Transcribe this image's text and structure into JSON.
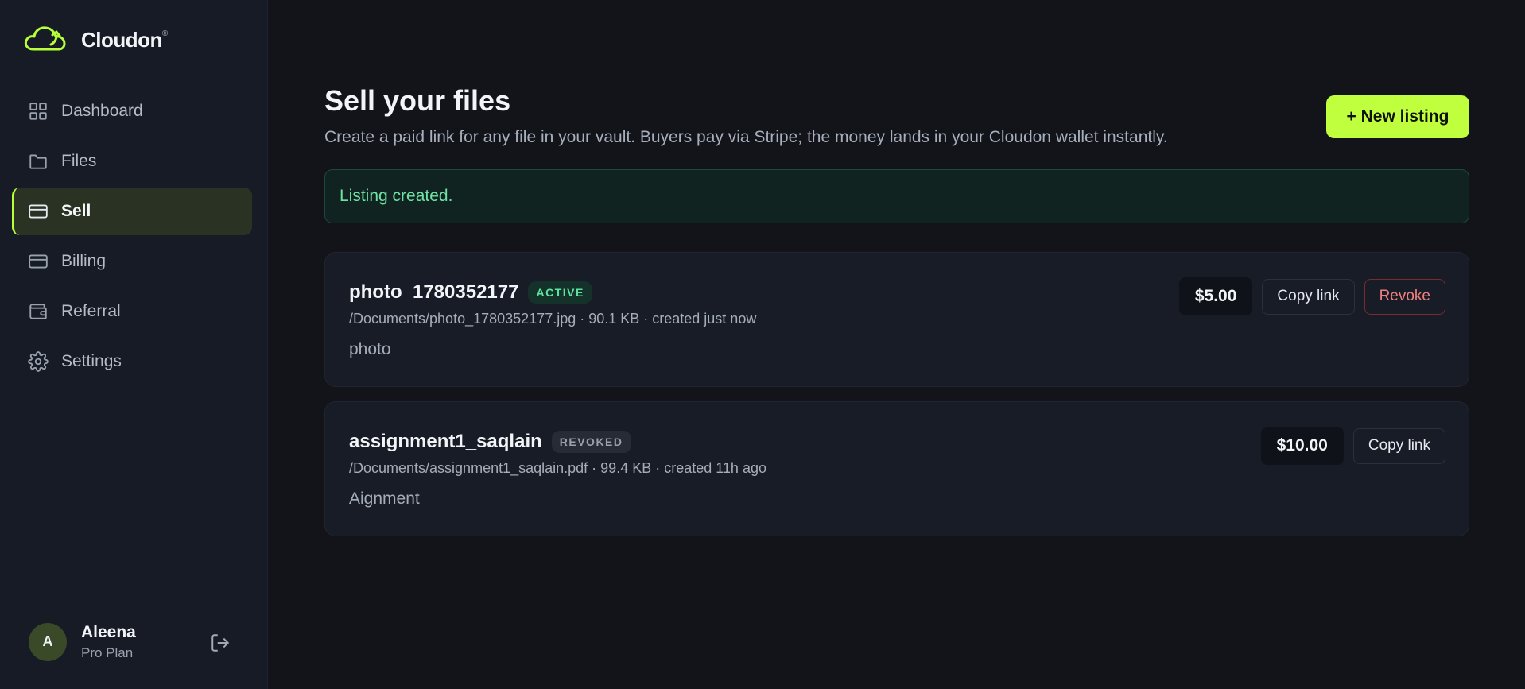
{
  "brand": {
    "name": "Cloudon",
    "mark": "®",
    "accent": "#b6ff3b"
  },
  "sidebar": {
    "items": [
      {
        "label": "Dashboard",
        "icon": "grid-icon"
      },
      {
        "label": "Files",
        "icon": "folder-icon"
      },
      {
        "label": "Sell",
        "icon": "card-icon",
        "active": true
      },
      {
        "label": "Billing",
        "icon": "card-icon"
      },
      {
        "label": "Referral",
        "icon": "wallet-icon"
      },
      {
        "label": "Settings",
        "icon": "gear-icon"
      }
    ]
  },
  "user": {
    "initial": "A",
    "name": "Aleena",
    "plan": "Pro Plan"
  },
  "page": {
    "title": "Sell your files",
    "subtitle": "Create a paid link for any file in your vault. Buyers pay via Stripe; the money lands in your Cloudon wallet instantly.",
    "new_listing_label": "+ New listing",
    "alert": "Listing created."
  },
  "listings": [
    {
      "name": "photo_1780352177",
      "status": "ACTIVE",
      "meta": "/Documents/photo_1780352177.jpg · 90.1 KB · created just now",
      "description": "photo",
      "price": "$5.00",
      "copy_label": "Copy link",
      "revoke_label": "Revoke"
    },
    {
      "name": "assignment1_saqlain",
      "status": "REVOKED",
      "meta": "/Documents/assignment1_saqlain.pdf · 99.4 KB · created 11h ago",
      "description": "Aignment",
      "price": "$10.00",
      "copy_label": "Copy link"
    }
  ]
}
